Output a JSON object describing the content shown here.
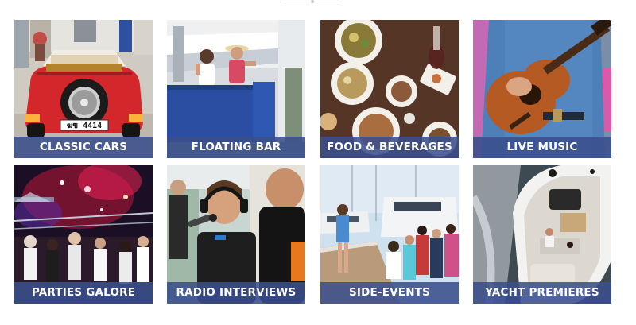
{
  "colors": {
    "caption_band": "#3a4e8c",
    "caption_text": "#ffffff",
    "page_background": "#ffffff"
  },
  "tiles": [
    {
      "label": "CLASSIC CARS",
      "photo": "red-vintage-car-rear-with-spare-wheel",
      "plate": "ฆข 4414"
    },
    {
      "label": "FLOATING BAR",
      "photo": "two-women-in-blue-floating-bar-at-marina"
    },
    {
      "label": "FOOD & BEVERAGES",
      "photo": "table-with-plates-of-food-and-drinks"
    },
    {
      "label": "LIVE MUSIC",
      "photo": "man-playing-acoustic-guitar"
    },
    {
      "label": "PARTIES GALORE",
      "photo": "night-party-crowd-under-red-lights"
    },
    {
      "label": "RADIO INTERVIEWS",
      "photo": "man-with-headphones-at-microphone-and-host"
    },
    {
      "label": "SIDE-EVENTS",
      "photo": "people-on-marina-dock-beside-yachts"
    },
    {
      "label": "YACHT PREMIERES",
      "photo": "aerial-view-of-motor-yacht-at-sea"
    }
  ]
}
